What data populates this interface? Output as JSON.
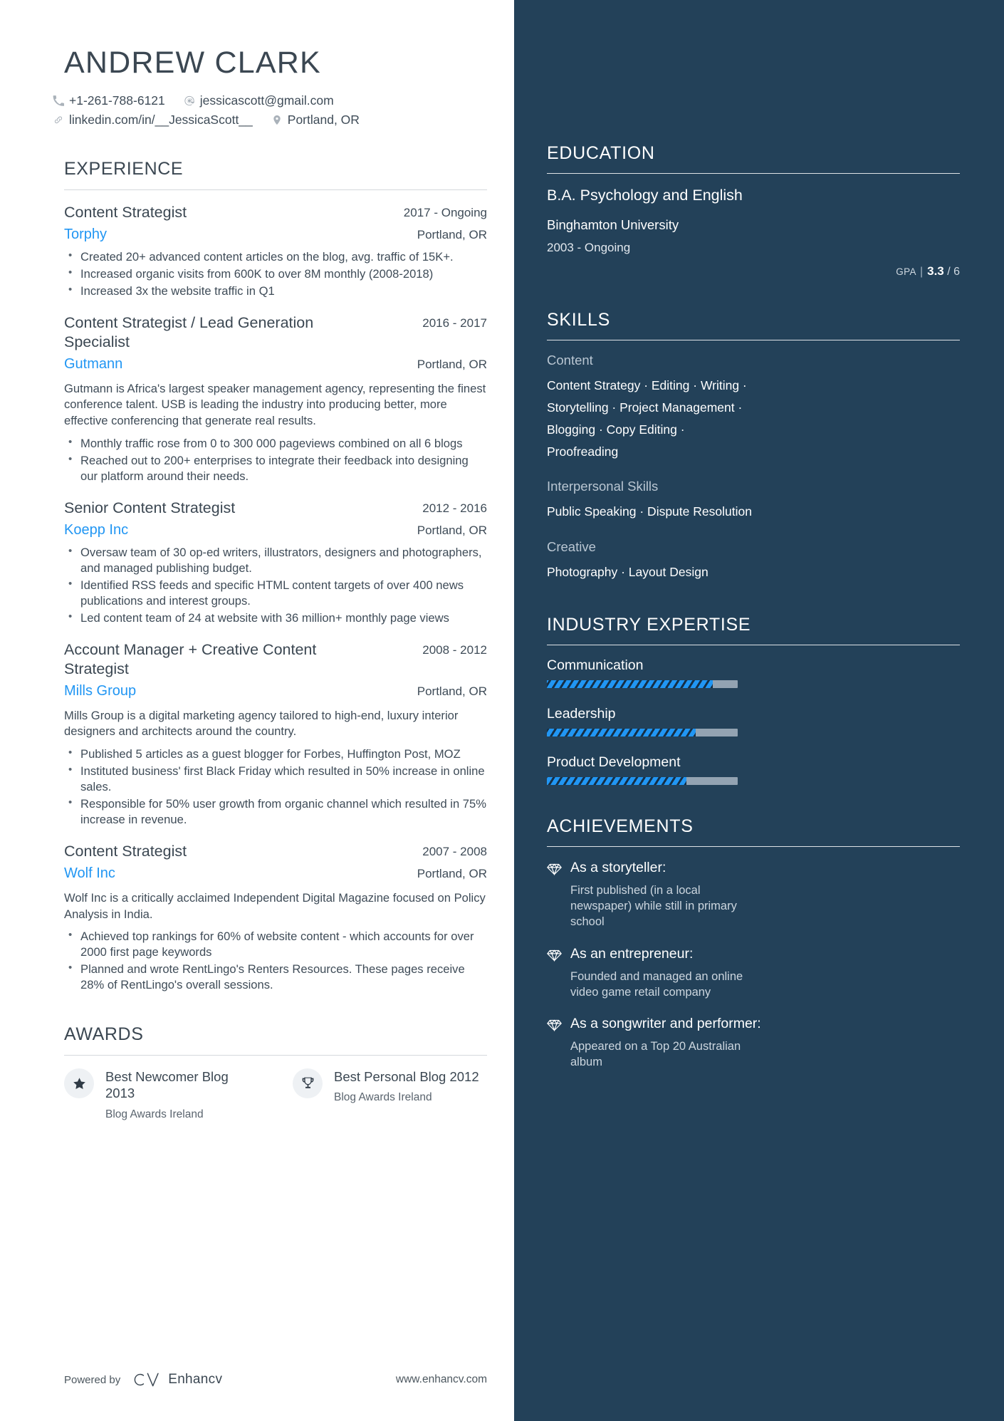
{
  "header": {
    "name": "ANDREW CLARK",
    "contacts_row1": [
      {
        "icon": "phone-icon",
        "text": "+1-261-788-6121"
      },
      {
        "icon": "email-icon",
        "text": "jessicascott@gmail.com"
      }
    ],
    "contacts_row2": [
      {
        "icon": "link-icon",
        "text": "linkedin.com/in/__JessicaScott__"
      },
      {
        "icon": "location-pin-icon",
        "text": "Portland, OR"
      }
    ]
  },
  "experience": {
    "heading": "EXPERIENCE",
    "jobs": [
      {
        "title": "Content Strategist",
        "date": "2017 - Ongoing",
        "company": "Torphy",
        "location": "Portland, OR",
        "description": "",
        "bullets": [
          "Created 20+ advanced content articles on the blog, avg. traffic of 15K+.",
          "Increased organic visits from 600K to over 8M monthly (2008-2018)",
          "Increased 3x the website traffic in Q1"
        ]
      },
      {
        "title": "Content Strategist / Lead Generation Specialist",
        "date": "2016 - 2017",
        "company": "Gutmann",
        "location": "Portland, OR",
        "description": "Gutmann is Africa's largest speaker management agency, representing the finest conference talent. USB is leading the industry into producing better, more effective conferencing that generate real results.",
        "bullets": [
          "Monthly traffic rose from 0 to 300 000 pageviews combined on all 6 blogs",
          "Reached out to 200+ enterprises to integrate their feedback into designing our platform around their needs."
        ]
      },
      {
        "title": "Senior Content Strategist",
        "date": "2012 - 2016",
        "company": "Koepp Inc",
        "location": "Portland, OR",
        "description": "",
        "bullets": [
          "Oversaw team of 30 op-ed writers, illustrators, designers and photographers, and managed publishing budget.",
          "Identified RSS feeds and specific HTML content targets of over 400 news publications and interest groups.",
          "Led content team of 24 at website with 36 million+ monthly page views"
        ]
      },
      {
        "title": "Account Manager + Creative Content Strategist",
        "date": "2008 - 2012",
        "company": "Mills Group",
        "location": "Portland, OR",
        "description": "Mills Group is a digital marketing agency tailored to high-end, luxury interior designers and architects around the country.",
        "bullets": [
          "Published 5 articles as a guest blogger for Forbes, Huffington Post, MOZ",
          "Instituted business' first Black Friday which resulted in 50% increase in online sales.",
          "Responsible for 50% user growth from organic channel which resulted in 75% increase in revenue."
        ]
      },
      {
        "title": "Content Strategist",
        "date": "2007 - 2008",
        "company": "Wolf Inc",
        "location": "Portland, OR",
        "description": "Wolf Inc is a critically acclaimed Independent Digital Magazine focused on Policy Analysis in India.",
        "bullets": [
          "Achieved top rankings for 60% of website content - which accounts for over 2000 first page keywords",
          "Planned and wrote RentLingo's Renters Resources. These pages receive 28% of RentLingo's overall sessions."
        ]
      }
    ]
  },
  "awards": {
    "heading": "AWARDS",
    "items": [
      {
        "icon": "star-icon",
        "title": "Best Newcomer Blog 2013",
        "subtitle": "Blog Awards Ireland"
      },
      {
        "icon": "trophy-icon",
        "title": "Best Personal Blog 2012",
        "subtitle": "Blog Awards Ireland"
      }
    ]
  },
  "footer": {
    "powered_by": "Powered by",
    "brand": "Enhancv",
    "website": "www.enhancv.com"
  },
  "education": {
    "heading": "EDUCATION",
    "degree": "B.A. Psychology and English",
    "school": "Binghamton University",
    "date": "2003 - Ongoing",
    "gpa_label": "GPA",
    "gpa_value": "3.3",
    "gpa_max": "/ 6"
  },
  "skills": {
    "heading": "SKILLS",
    "groups": [
      {
        "category": "Content",
        "list": "Content Strategy · Editing · Writing · Storytelling · Project Management · Blogging · Copy Editing · Proofreading"
      },
      {
        "category": "Interpersonal Skills",
        "list": "Public Speaking · Dispute Resolution"
      },
      {
        "category": "Creative",
        "list": "Photography · Layout Design"
      }
    ]
  },
  "industry_expertise": {
    "heading": "INDUSTRY EXPERTISE",
    "items": [
      {
        "label": "Communication",
        "percent": 87
      },
      {
        "label": "Leadership",
        "percent": 78
      },
      {
        "label": "Product Development",
        "percent": 73
      }
    ],
    "accent_color": "#2196f3",
    "track_color": "#93a3b2"
  },
  "achievements": {
    "heading": "ACHIEVEMENTS",
    "items": [
      {
        "icon": "diamond-icon",
        "title": "As a storyteller:",
        "text": "First published (in a local newspaper) while still in primary school"
      },
      {
        "icon": "diamond-icon",
        "title": "As an entrepreneur:",
        "text": "Founded and managed an online video game retail company"
      },
      {
        "icon": "diamond-icon",
        "title": "As a songwriter and performer:",
        "text": "Appeared on a Top 20 Australian album"
      }
    ]
  },
  "theme": {
    "sidebar_bg": "#234159",
    "company_link": "#2196f3",
    "body_text": "#3f4c58"
  }
}
